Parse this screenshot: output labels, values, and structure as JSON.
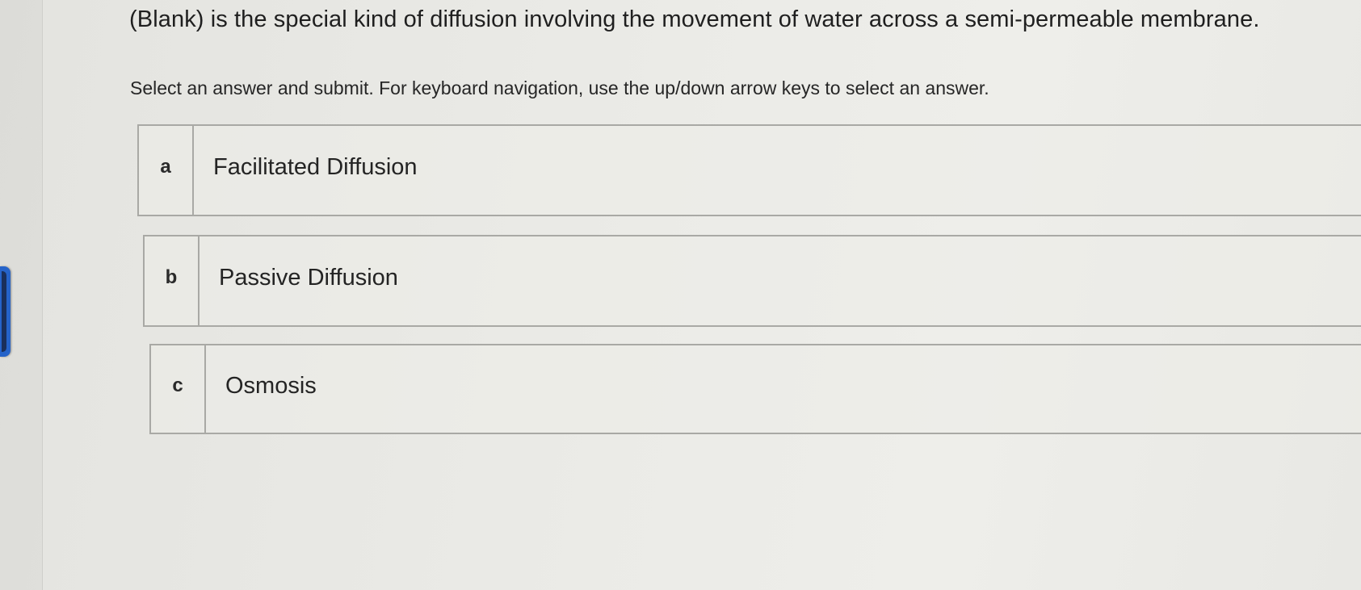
{
  "question": {
    "text": "(Blank) is the special kind of diffusion involving the movement of water across a semi-permeable membrane."
  },
  "instructions": "Select an answer and submit. For keyboard navigation, use the up/down arrow keys to select an answer.",
  "options": [
    {
      "letter": "a",
      "label": "Facilitated Diffusion"
    },
    {
      "letter": "b",
      "label": "Passive Diffusion"
    },
    {
      "letter": "c",
      "label": "Osmosis"
    }
  ],
  "colors": {
    "side_tab": "#2563c9",
    "border": "#a9a9a5",
    "background": "#e9e9e5"
  }
}
